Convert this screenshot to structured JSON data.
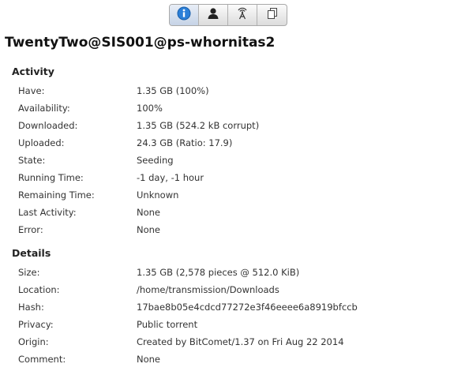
{
  "tabs": [
    {
      "icon": "info-icon",
      "active": true
    },
    {
      "icon": "peers-icon",
      "active": false
    },
    {
      "icon": "trackers-icon",
      "active": false
    },
    {
      "icon": "files-icon",
      "active": false
    }
  ],
  "title": "TwentyTwo@SIS001@ps-whornitas2",
  "activity": {
    "heading": "Activity",
    "rows": [
      {
        "label": "Have:",
        "value": "1.35 GB (100%)"
      },
      {
        "label": "Availability:",
        "value": "100%"
      },
      {
        "label": "Downloaded:",
        "value": "1.35 GB (524.2 kB corrupt)"
      },
      {
        "label": "Uploaded:",
        "value": "24.3 GB (Ratio: 17.9)"
      },
      {
        "label": "State:",
        "value": "Seeding"
      },
      {
        "label": "Running Time:",
        "value": "-1 day, -1 hour"
      },
      {
        "label": "Remaining Time:",
        "value": "Unknown"
      },
      {
        "label": "Last Activity:",
        "value": "None"
      },
      {
        "label": "Error:",
        "value": "None"
      }
    ]
  },
  "details": {
    "heading": "Details",
    "rows": [
      {
        "label": "Size:",
        "value": "1.35 GB (2,578 pieces @ 512.0 KiB)"
      },
      {
        "label": "Location:",
        "value": "/home/transmission/Downloads"
      },
      {
        "label": "Hash:",
        "value": "17bae8b05e4cdcd77272e3f46eeee6a8919bfccb"
      },
      {
        "label": "Privacy:",
        "value": "Public torrent"
      },
      {
        "label": "Origin:",
        "value": "Created by BitComet/1.37 on Fri Aug 22 2014"
      },
      {
        "label": "Comment:",
        "value": "None"
      }
    ]
  }
}
